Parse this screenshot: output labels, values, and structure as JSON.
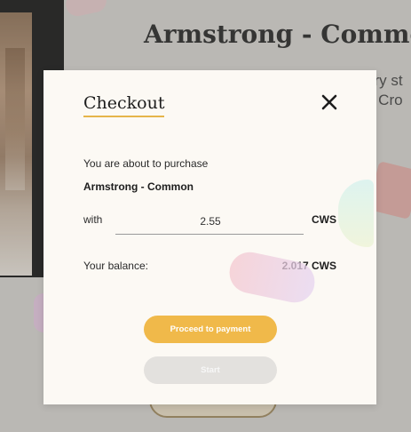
{
  "background": {
    "title": "Armstrong - Common",
    "description_lines": [
      "ery st",
      "g Cro"
    ]
  },
  "modal": {
    "title": "Checkout",
    "intro": "You are about to purchase",
    "item_name": "Armstrong - Common",
    "with_label": "with",
    "amount_value": "2.55",
    "amount_currency": "CWS",
    "balance_label": "Your balance:",
    "balance_value": "2.017 CWS",
    "proceed_button": "Proceed to payment",
    "start_button": "Start"
  },
  "icons": {
    "close": "close-icon"
  },
  "colors": {
    "accent": "#f0b94a",
    "underline": "#e6b54a",
    "modal_bg": "#fcf9f4",
    "disabled_button": "#e3e1de"
  }
}
